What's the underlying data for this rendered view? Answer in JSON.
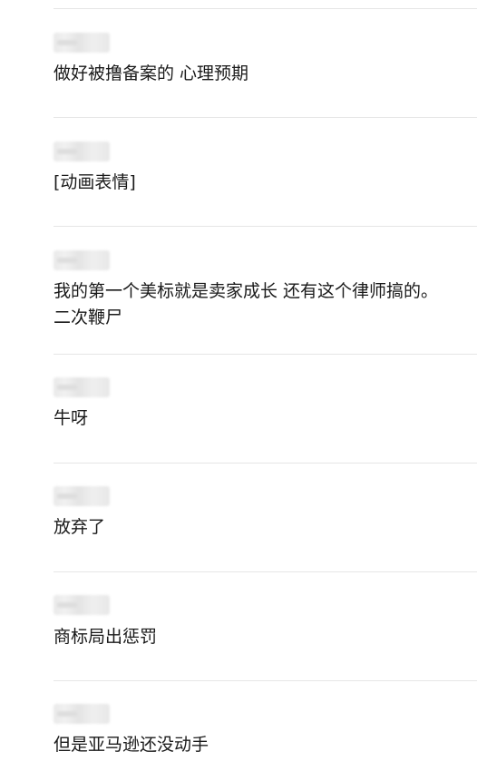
{
  "comments": [
    {
      "text": "做好被撸备案的 心理预期"
    },
    {
      "text": "[动画表情]"
    },
    {
      "text": "我的第一个美标就是卖家成长 还有这个律师搞的。\n二次鞭尸"
    },
    {
      "text": "牛呀"
    },
    {
      "text": "放弃了"
    },
    {
      "text": "商标局出惩罚"
    },
    {
      "text": "但是亚马逊还没动手"
    }
  ]
}
